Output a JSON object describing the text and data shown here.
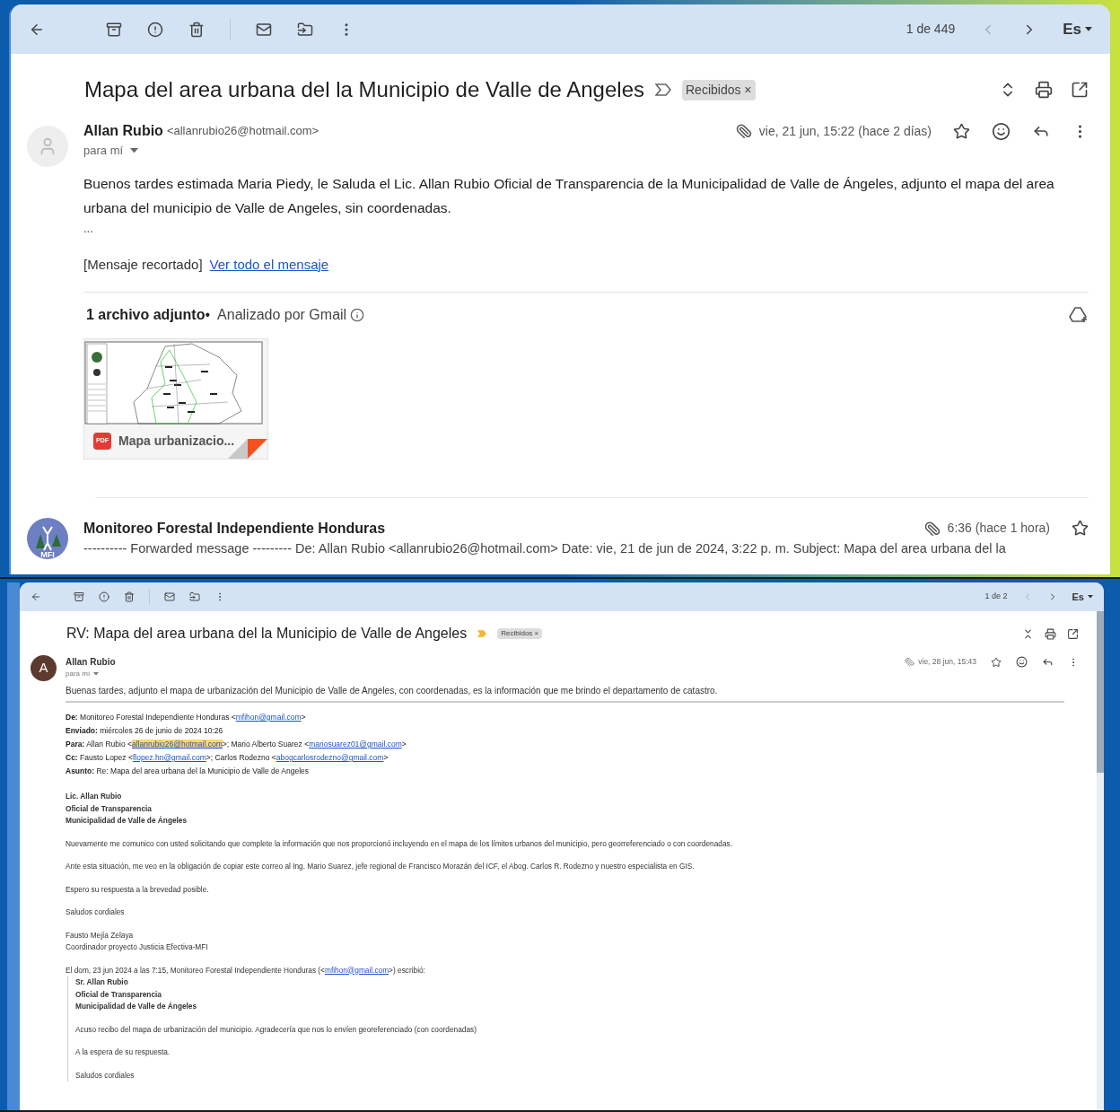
{
  "top_view": {
    "toolbar": {
      "counter": "1 de 449",
      "language": "Es"
    },
    "subject": "Mapa del area urbana del la Municipio de Valle de Angeles",
    "important": false,
    "label": {
      "text": "Recibidos",
      "remove": "×"
    },
    "message": {
      "sender": "Allan Rubio",
      "email": "<allanrubio26@hotmail.com>",
      "to": "para mí",
      "date": "vie, 21 jun, 15:22 (hace 2 días)",
      "starred": false,
      "body": "Buenos tardes estimada Maria Piedy, le Saluda el Lic. Allan Rubio Oficial de Transparencia de la Municipalidad de Valle de Ángeles, adjunto el mapa del area urbana del municipio de Valle de Angeles, sin coordenadas.",
      "ellipsis": "...",
      "clipped": "[Mensaje recortado]",
      "clipped_link": "Ver todo el mensaje"
    },
    "attachments": {
      "count": "1 archivo adjunto",
      "separator": "•",
      "scan": "Analizado por Gmail",
      "files": [
        {
          "type": "PDF",
          "name": "Mapa urbanizacio..."
        }
      ]
    },
    "next_message": {
      "avatar_text": "MFI",
      "sender": "Monitoreo Forestal Independiente Honduras",
      "time": "6:36 (hace 1 hora)",
      "starred": false,
      "snippet": "---------- Forwarded message --------- De: Allan Rubio <allanrubio26@hotmail.com> Date: vie, 21 de jun de 2024, 3:22 p. m. Subject: Mapa del area urbana del la"
    }
  },
  "bottom_view": {
    "toolbar": {
      "counter": "1 de 2",
      "language": "Es"
    },
    "subject": "RV: Mapa del area urbana del la Municipio de Valle de Angeles",
    "important": true,
    "label": {
      "text": "Recibidos",
      "remove": "×"
    },
    "message": {
      "avatar_letter": "A",
      "sender": "Allan Rubio",
      "to": "para mí",
      "date": "vie, 28 jun, 15:43",
      "starred": false,
      "body": "Buenas tardes, adjunto el mapa de urbanización del Municipio de Valle de Angeles, con coordenadas, es la información que me brindo el departamento de catastro."
    },
    "header_lines": [
      [
        {
          "kind": "text",
          "text": "**De:** Monitoreo Forestal Independiente Honduras <"
        },
        {
          "kind": "link",
          "text": "mfihon@gmail.com",
          "highlighted": false
        },
        {
          "kind": "text",
          "text": ">"
        }
      ],
      [
        {
          "kind": "text",
          "text": "**Enviado:** miércoles 26 de junio de 2024 10:26"
        }
      ],
      [
        {
          "kind": "text",
          "text": "**Para:** Allan Rubio <"
        },
        {
          "kind": "link",
          "text": "allanrubio26@hotmail.com",
          "highlighted": true
        },
        {
          "kind": "text",
          "text": ">; Mario Alberto Suarez <"
        },
        {
          "kind": "link",
          "text": "mariosuarez01@gmail.com",
          "highlighted": false
        },
        {
          "kind": "text",
          "text": ">"
        }
      ],
      [
        {
          "kind": "text",
          "text": "**Cc:** Fausto Lopez <"
        },
        {
          "kind": "link",
          "text": "flopez.hn@gmail.com",
          "highlighted": false
        },
        {
          "kind": "text",
          "text": ">; Carlos Rodezno <"
        },
        {
          "kind": "link",
          "text": "abogcarlosrodezno@gmail.com",
          "highlighted": false
        },
        {
          "kind": "text",
          "text": ">"
        }
      ],
      [
        {
          "kind": "text",
          "text": "**Asunto:** Re: Mapa del area urbana del la Municipio de Valle de Angeles"
        }
      ]
    ],
    "letter": [
      {
        "kind": "bold",
        "lines": [
          "Lic. Allan Rubio",
          "Oficial de Transparencia",
          "Municipalidad de Valle de Ángeles"
        ]
      },
      {
        "kind": "plain",
        "lines": [
          "Nuevamente me comunico con usted solicitando que complete la información que nos proporcionó incluyendo en el mapa de los límites urbanos del municipio, pero georreferenciado o con coordenadas."
        ]
      },
      {
        "kind": "plain",
        "lines": [
          "Ante esta situación, me veo en la obligación de copiar este correo al Ing. Mario Suarez, jefe regional de Francisco Morazán del ICF, el Abog. Carlos R. Rodezno y nuestro especialista en GIS."
        ]
      },
      {
        "kind": "plain",
        "lines": [
          "Espero su respuesta a la brevedad posible."
        ]
      },
      {
        "kind": "plain",
        "lines": [
          "Saludos cordiales"
        ]
      },
      {
        "kind": "plain",
        "lines": [
          "Fausto Mejía Zelaya",
          "Coordinador proyecto Justicia Efectiva-MFI"
        ]
      }
    ],
    "quote_intro": [
      {
        "kind": "text",
        "text": "El dom, 23 jun 2024 a las 7:15, Monitoreo Forestal Independiente Honduras (<"
      },
      {
        "kind": "link",
        "text": "mfihon@gmail.com",
        "highlighted": false
      },
      {
        "kind": "text",
        "text": ">) escribió:"
      }
    ],
    "quoted": [
      {
        "kind": "bold",
        "lines": [
          "Sr. Allan Rubio",
          "Oficial de Transparencia",
          "Municipalidad de Valle de Ángeles"
        ]
      },
      {
        "kind": "plain",
        "lines": [
          "Acuso recibo del mapa de urbanización del municipio. Agradecería que nos lo envíen georeferenciado (con coordenadas)"
        ]
      },
      {
        "kind": "plain",
        "lines": [
          "A la espera de su respuesta."
        ]
      },
      {
        "kind": "plain",
        "lines": [
          "Saludos cordiales"
        ]
      }
    ]
  }
}
